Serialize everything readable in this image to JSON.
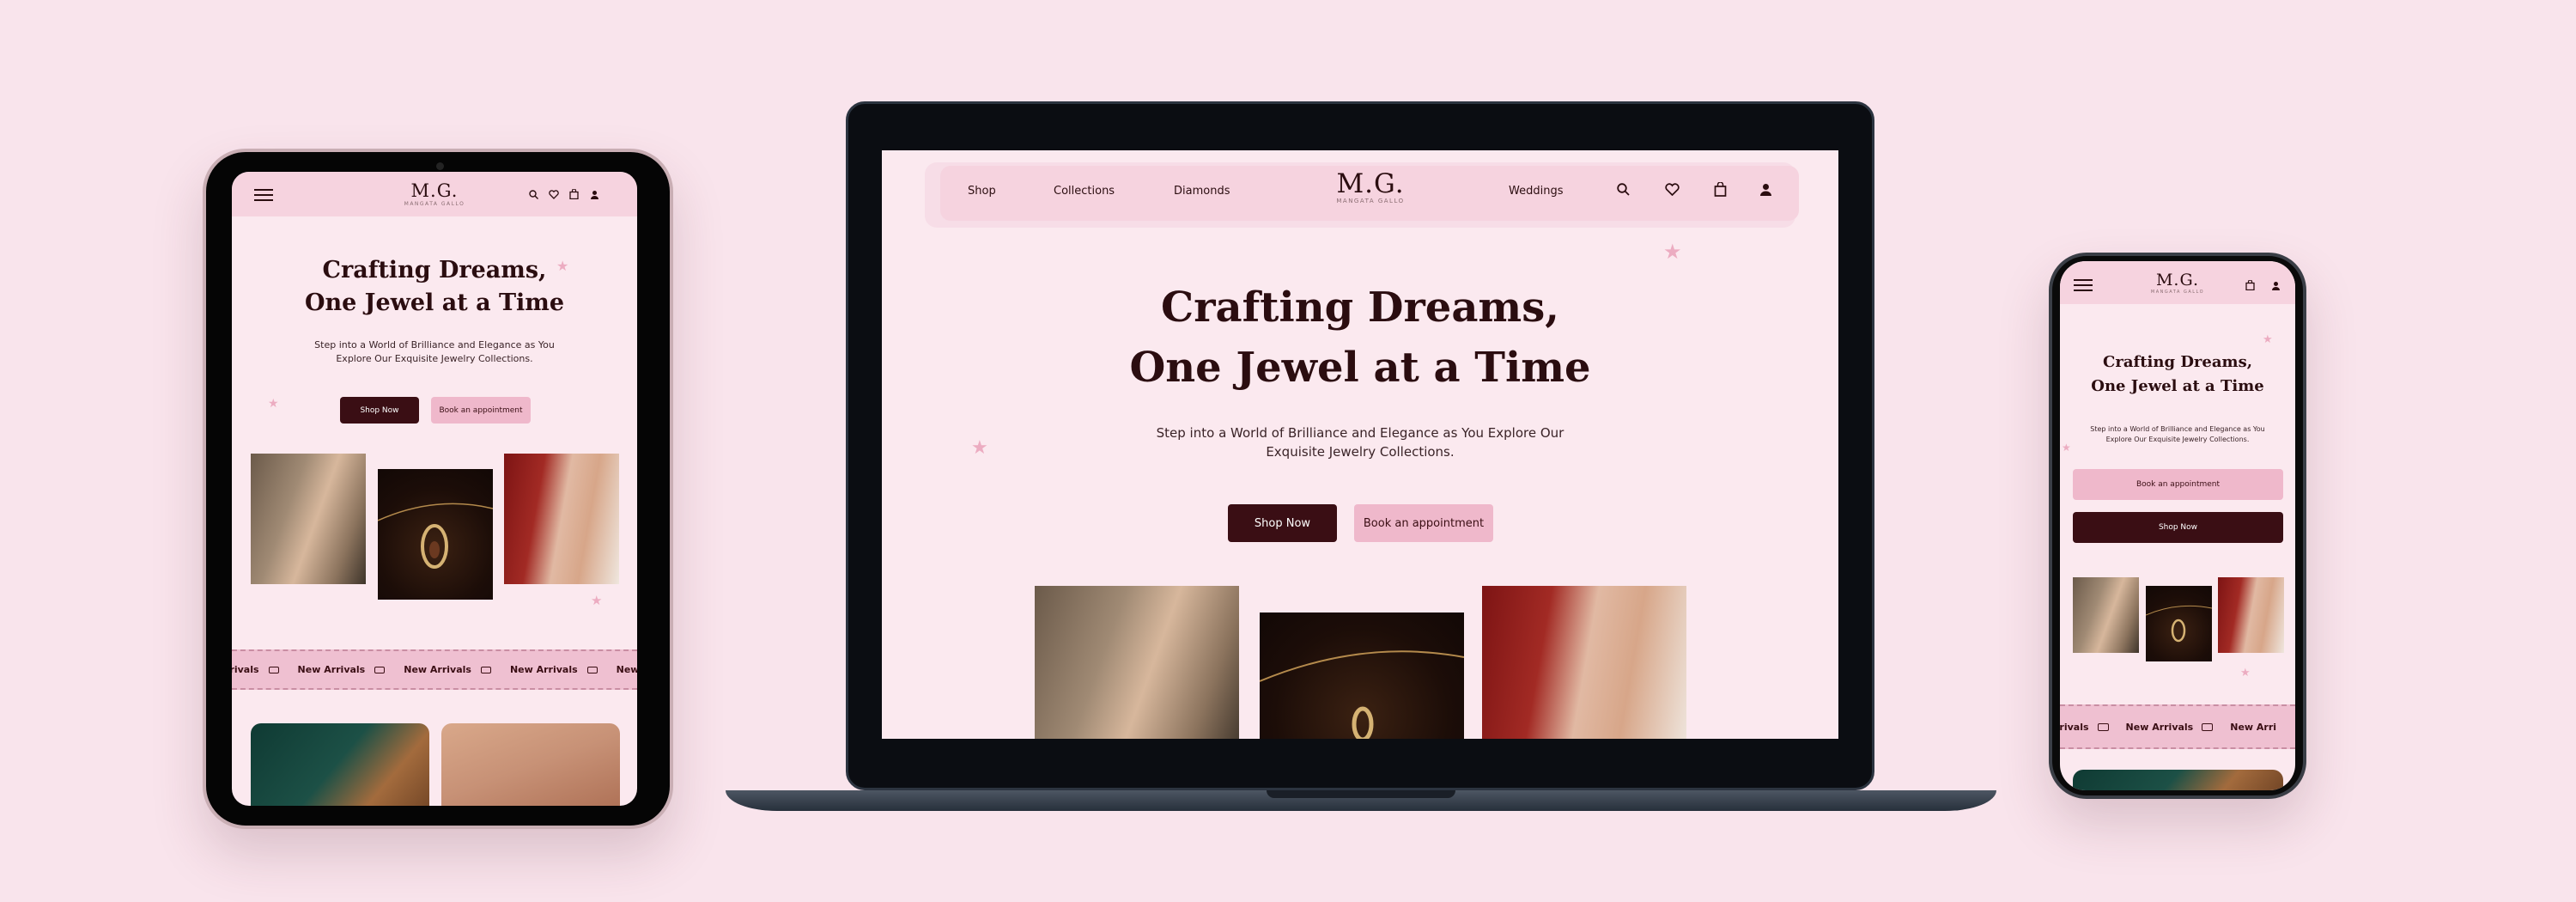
{
  "brand": {
    "logo": "M.G.",
    "tagline": "MANGATA GALLO"
  },
  "nav": {
    "items": [
      "Shop",
      "Collections",
      "Diamonds",
      "Weddings"
    ]
  },
  "icons": [
    "search-icon",
    "heart-icon",
    "bag-icon",
    "user-icon",
    "menu-icon",
    "truck-icon",
    "star-icon"
  ],
  "hero": {
    "title_line1": "Crafting Dreams,",
    "title_line2": "One Jewel at a Time",
    "subtitle_desktop_line1": "Step into a World of Brilliance and Elegance as You Explore Our",
    "subtitle_desktop_line2": "Exquisite Jewelry Collections.",
    "subtitle_tablet_line1": "Step into a World of Brilliance and Elegance as You",
    "subtitle_tablet_line2": "Explore Our Exquisite Jewelry Collections.",
    "subtitle_phone_line1": "Step into a World of Brilliance and Elegance as You",
    "subtitle_phone_line2": "Explore Our Exquisite Jewelry Collections.",
    "shop_now": "Shop Now",
    "book": "Book an appointment"
  },
  "marquee": {
    "tablet": [
      "rrivals",
      "New Arrivals",
      "New Arrivals",
      "New Arrivals",
      "New Arrivals",
      "New Arriv"
    ],
    "phone": [
      "rrivals",
      "New Arrivals",
      "New Arri"
    ]
  },
  "colors": {
    "background": "#f9e4ec",
    "dark": "#3a0e14",
    "pink": "#efb8cb",
    "page": "#fbe9ef"
  }
}
